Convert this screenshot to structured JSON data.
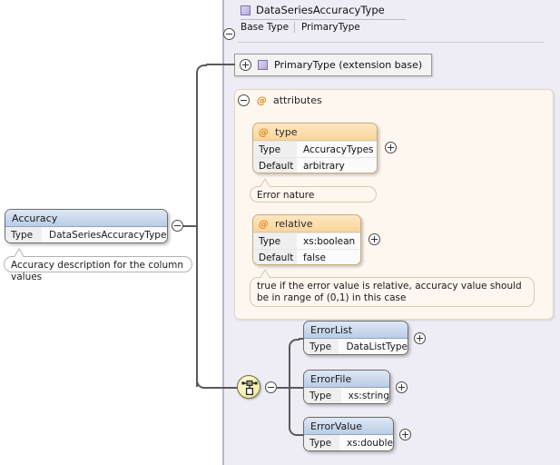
{
  "diagram": {
    "kind": "xsd-schema-diagram",
    "colors": {
      "panel_background": "#eeecf4",
      "panel_border": "#b9b4c9",
      "attributes_background": "#fdf7ef",
      "attributes_border": "#e2d6c4",
      "attribute_header_gradient_top": "#fde6c2",
      "attribute_header_gradient_bottom": "#fbd69b",
      "element_header_gradient_top": "#dfe8f5",
      "element_header_gradient_bottom": "#b9cde6",
      "connector_line": "#5a5a5a",
      "choice_icon_fill": "#f3edaa",
      "at_symbol": "#e08a1e",
      "type_icon": "#b5a8dd"
    }
  },
  "root_element": {
    "name": "Accuracy",
    "type_key": "Type",
    "type_value": "DataSeriesAccuracyType",
    "toggle": "minus-circle",
    "documentation": "Accuracy description for the column values"
  },
  "complex_type": {
    "name": "DataSeriesAccuracyType",
    "toggle": "minus-circle",
    "icon": "complex-type-icon",
    "base_type_label": "Base Type",
    "base_type_value": "PrimaryType"
  },
  "extension_base": {
    "label": "PrimaryType (extension base)",
    "toggle": "plus-circle",
    "icon": "complex-type-icon"
  },
  "attributes_group": {
    "label": "attributes",
    "symbol": "@",
    "toggle": "minus-circle",
    "items": [
      {
        "name": "type",
        "symbol": "@",
        "toggle": "plus-circle",
        "rows": [
          {
            "key": "Type",
            "value": "AccuracyTypes"
          },
          {
            "key": "Default",
            "value": "arbitrary"
          }
        ],
        "documentation": "Error nature"
      },
      {
        "name": "relative",
        "symbol": "@",
        "toggle": "plus-circle",
        "rows": [
          {
            "key": "Type",
            "value": "xs:boolean"
          },
          {
            "key": "Default",
            "value": "false"
          }
        ],
        "documentation": "true if the error value is relative, accuracy value should be in range of (0,1) in this case"
      }
    ]
  },
  "content_model": {
    "compositor": "choice",
    "compositor_icon": "choice-icon",
    "toggle": "minus-circle",
    "elements": [
      {
        "name": "ErrorList",
        "toggle": "plus-circle",
        "rows": [
          {
            "key": "Type",
            "value": "DataListType"
          }
        ]
      },
      {
        "name": "ErrorFile",
        "toggle": "plus-circle",
        "rows": [
          {
            "key": "Type",
            "value": "xs:string"
          }
        ]
      },
      {
        "name": "ErrorValue",
        "toggle": "plus-circle",
        "rows": [
          {
            "key": "Type",
            "value": "xs:double"
          }
        ]
      }
    ]
  }
}
